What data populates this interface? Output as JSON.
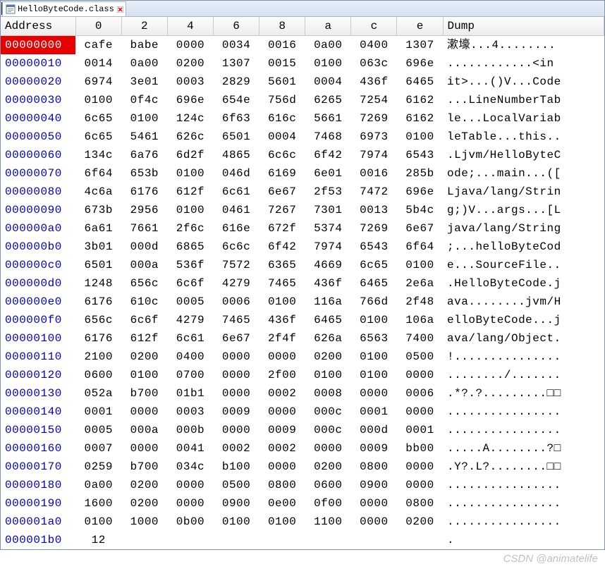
{
  "tab": {
    "label": "HelloByteCode.class"
  },
  "headers": {
    "address": "Address",
    "cols": [
      "0",
      "2",
      "4",
      "6",
      "8",
      "a",
      "c",
      "e"
    ],
    "dump": "Dump"
  },
  "selected_row": 0,
  "cursor": {
    "row": 0,
    "col": 3
  },
  "rows": [
    {
      "addr": "00000000",
      "b": [
        "cafe",
        "babe",
        "0000",
        "0034",
        "0016",
        "0a00",
        "0400",
        "1307"
      ],
      "dump": "漱壕...4........"
    },
    {
      "addr": "00000010",
      "b": [
        "0014",
        "0a00",
        "0200",
        "1307",
        "0015",
        "0100",
        "063c",
        "696e"
      ],
      "dump": "............<in"
    },
    {
      "addr": "00000020",
      "b": [
        "6974",
        "3e01",
        "0003",
        "2829",
        "5601",
        "0004",
        "436f",
        "6465"
      ],
      "dump": "it>...()V...Code"
    },
    {
      "addr": "00000030",
      "b": [
        "0100",
        "0f4c",
        "696e",
        "654e",
        "756d",
        "6265",
        "7254",
        "6162"
      ],
      "dump": "...LineNumberTab"
    },
    {
      "addr": "00000040",
      "b": [
        "6c65",
        "0100",
        "124c",
        "6f63",
        "616c",
        "5661",
        "7269",
        "6162"
      ],
      "dump": "le...LocalVariab"
    },
    {
      "addr": "00000050",
      "b": [
        "6c65",
        "5461",
        "626c",
        "6501",
        "0004",
        "7468",
        "6973",
        "0100"
      ],
      "dump": "leTable...this.."
    },
    {
      "addr": "00000060",
      "b": [
        "134c",
        "6a76",
        "6d2f",
        "4865",
        "6c6c",
        "6f42",
        "7974",
        "6543"
      ],
      "dump": ".Ljvm/HelloByteC"
    },
    {
      "addr": "00000070",
      "b": [
        "6f64",
        "653b",
        "0100",
        "046d",
        "6169",
        "6e01",
        "0016",
        "285b"
      ],
      "dump": "ode;...main...(["
    },
    {
      "addr": "00000080",
      "b": [
        "4c6a",
        "6176",
        "612f",
        "6c61",
        "6e67",
        "2f53",
        "7472",
        "696e"
      ],
      "dump": "Ljava/lang/Strin"
    },
    {
      "addr": "00000090",
      "b": [
        "673b",
        "2956",
        "0100",
        "0461",
        "7267",
        "7301",
        "0013",
        "5b4c"
      ],
      "dump": "g;)V...args...[L"
    },
    {
      "addr": "000000a0",
      "b": [
        "6a61",
        "7661",
        "2f6c",
        "616e",
        "672f",
        "5374",
        "7269",
        "6e67"
      ],
      "dump": "java/lang/String"
    },
    {
      "addr": "000000b0",
      "b": [
        "3b01",
        "000d",
        "6865",
        "6c6c",
        "6f42",
        "7974",
        "6543",
        "6f64"
      ],
      "dump": ";...helloByteCod"
    },
    {
      "addr": "000000c0",
      "b": [
        "6501",
        "000a",
        "536f",
        "7572",
        "6365",
        "4669",
        "6c65",
        "0100"
      ],
      "dump": "e...SourceFile.."
    },
    {
      "addr": "000000d0",
      "b": [
        "1248",
        "656c",
        "6c6f",
        "4279",
        "7465",
        "436f",
        "6465",
        "2e6a"
      ],
      "dump": ".HelloByteCode.j"
    },
    {
      "addr": "000000e0",
      "b": [
        "6176",
        "610c",
        "0005",
        "0006",
        "0100",
        "116a",
        "766d",
        "2f48"
      ],
      "dump": "ava........jvm/H"
    },
    {
      "addr": "000000f0",
      "b": [
        "656c",
        "6c6f",
        "4279",
        "7465",
        "436f",
        "6465",
        "0100",
        "106a"
      ],
      "dump": "elloByteCode...j"
    },
    {
      "addr": "00000100",
      "b": [
        "6176",
        "612f",
        "6c61",
        "6e67",
        "2f4f",
        "626a",
        "6563",
        "7400"
      ],
      "dump": "ava/lang/Object."
    },
    {
      "addr": "00000110",
      "b": [
        "2100",
        "0200",
        "0400",
        "0000",
        "0000",
        "0200",
        "0100",
        "0500"
      ],
      "dump": "!..............."
    },
    {
      "addr": "00000120",
      "b": [
        "0600",
        "0100",
        "0700",
        "0000",
        "2f00",
        "0100",
        "0100",
        "0000"
      ],
      "dump": "......../......."
    },
    {
      "addr": "00000130",
      "b": [
        "052a",
        "b700",
        "01b1",
        "0000",
        "0002",
        "0008",
        "0000",
        "0006"
      ],
      "dump": ".*?.?.........□□"
    },
    {
      "addr": "00000140",
      "b": [
        "0001",
        "0000",
        "0003",
        "0009",
        "0000",
        "000c",
        "0001",
        "0000"
      ],
      "dump": "................"
    },
    {
      "addr": "00000150",
      "b": [
        "0005",
        "000a",
        "000b",
        "0000",
        "0009",
        "000c",
        "000d",
        "0001"
      ],
      "dump": "................"
    },
    {
      "addr": "00000160",
      "b": [
        "0007",
        "0000",
        "0041",
        "0002",
        "0002",
        "0000",
        "0009",
        "bb00"
      ],
      "dump": ".....A........?□"
    },
    {
      "addr": "00000170",
      "b": [
        "0259",
        "b700",
        "034c",
        "b100",
        "0000",
        "0200",
        "0800",
        "0000"
      ],
      "dump": ".Y?.L?........□□"
    },
    {
      "addr": "00000180",
      "b": [
        "0a00",
        "0200",
        "0000",
        "0500",
        "0800",
        "0600",
        "0900",
        "0000"
      ],
      "dump": "................"
    },
    {
      "addr": "00000190",
      "b": [
        "1600",
        "0200",
        "0000",
        "0900",
        "0e00",
        "0f00",
        "0000",
        "0800"
      ],
      "dump": "................"
    },
    {
      "addr": "000001a0",
      "b": [
        "0100",
        "1000",
        "0b00",
        "0100",
        "0100",
        "1100",
        "0000",
        "0200"
      ],
      "dump": "................"
    },
    {
      "addr": "000001b0",
      "b": [
        "12",
        "",
        "",
        "",
        "",
        "",
        "",
        ""
      ],
      "dump": "."
    }
  ],
  "watermark": "CSDN @animatelife"
}
